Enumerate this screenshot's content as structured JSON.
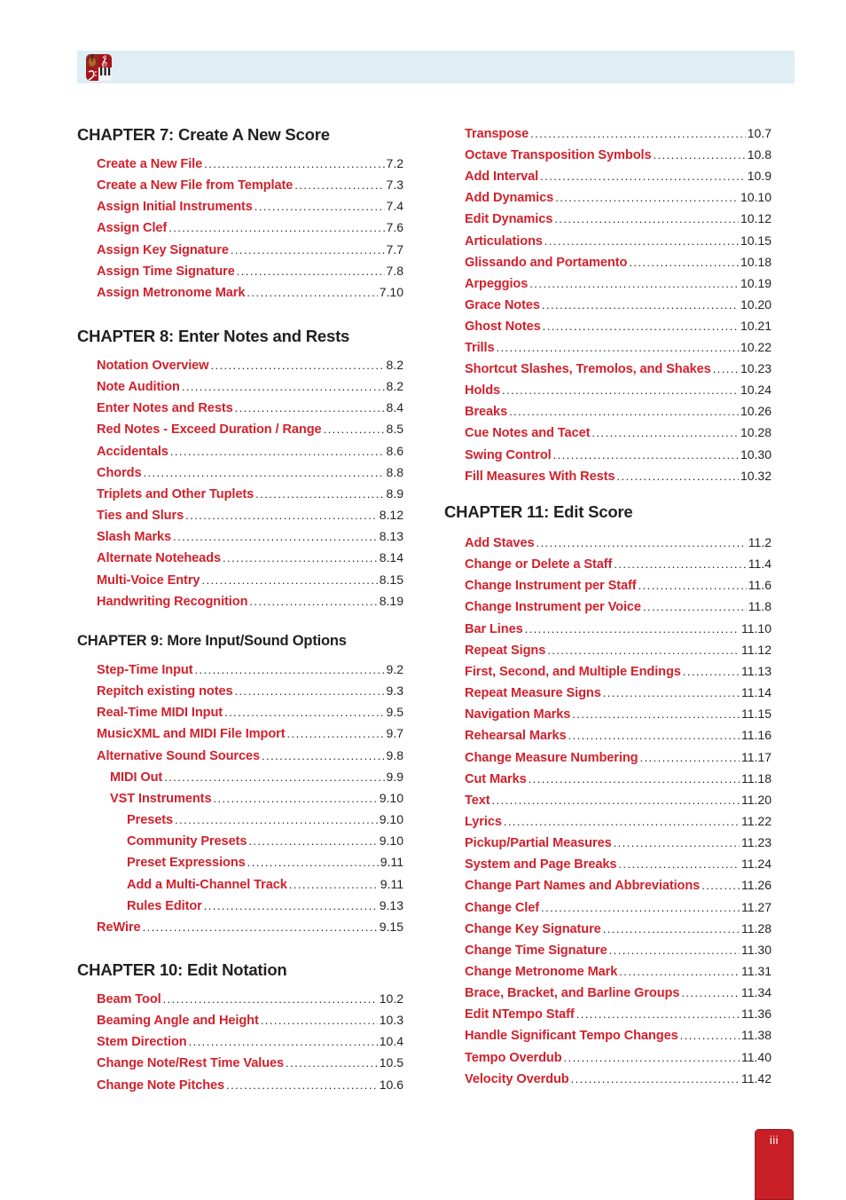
{
  "header": {
    "logo_icon": "notion-app-logo-violin-clef-piano-icon"
  },
  "left_column": [
    {
      "title": "CHAPTER 7: Create A New Score",
      "items": [
        {
          "label": "Create a New File",
          "page": "7.2",
          "indent": 0
        },
        {
          "label": "Create a New File from Template",
          "page": "7.3",
          "indent": 0
        },
        {
          "label": "Assign Initial Instruments",
          "page": "7.4",
          "indent": 0
        },
        {
          "label": "Assign Clef",
          "page": "7.6",
          "indent": 0
        },
        {
          "label": "Assign Key Signature",
          "page": "7.7",
          "indent": 0
        },
        {
          "label": "Assign Time Signature",
          "page": "7.8",
          "indent": 0
        },
        {
          "label": "Assign Metronome Mark",
          "page": "7.10",
          "indent": 0
        }
      ]
    },
    {
      "title": "CHAPTER 8: Enter Notes and Rests",
      "items": [
        {
          "label": "Notation Overview",
          "page": "8.2",
          "indent": 0
        },
        {
          "label": "Note Audition",
          "page": "8.2",
          "indent": 0
        },
        {
          "label": "Enter Notes and Rests",
          "page": "8.4",
          "indent": 0
        },
        {
          "label": "Red Notes - Exceed Duration / Range",
          "page": "8.5",
          "indent": 0
        },
        {
          "label": "Accidentals",
          "page": "8.6",
          "indent": 0
        },
        {
          "label": "Chords",
          "page": "8.8",
          "indent": 0
        },
        {
          "label": "Triplets and Other Tuplets",
          "page": "8.9",
          "indent": 0
        },
        {
          "label": "Ties and Slurs",
          "page": "8.12",
          "indent": 0
        },
        {
          "label": "Slash Marks",
          "page": "8.13",
          "indent": 0
        },
        {
          "label": "Alternate Noteheads",
          "page": "8.14",
          "indent": 0
        },
        {
          "label": "Multi-Voice Entry",
          "page": "8.15",
          "indent": 0
        },
        {
          "label": "Handwriting Recognition",
          "page": "8.19",
          "indent": 0
        }
      ]
    },
    {
      "title": "CHAPTER 9: More Input/Sound Options",
      "items": [
        {
          "label": "Step-Time Input",
          "page": "9.2",
          "indent": 0
        },
        {
          "label": "Repitch existing notes",
          "page": "9.3",
          "indent": 0
        },
        {
          "label": "Real-Time MIDI Input",
          "page": "9.5",
          "indent": 0
        },
        {
          "label": "MusicXML and MIDI File Import",
          "page": "9.7",
          "indent": 0
        },
        {
          "label": "Alternative Sound Sources",
          "page": "9.8",
          "indent": 0
        },
        {
          "label": "MIDI Out",
          "page": "9.9",
          "indent": 1
        },
        {
          "label": "VST Instruments",
          "page": "9.10",
          "indent": 1
        },
        {
          "label": "Presets",
          "page": "9.10",
          "indent": 2
        },
        {
          "label": "Community Presets",
          "page": "9.10",
          "indent": 2
        },
        {
          "label": "Preset Expressions",
          "page": "9.11",
          "indent": 2
        },
        {
          "label": "Add a Multi-Channel Track",
          "page": "9.11",
          "indent": 2
        },
        {
          "label": "Rules Editor",
          "page": "9.13",
          "indent": 2
        },
        {
          "label": "ReWire",
          "page": "9.15",
          "indent": 0
        }
      ]
    },
    {
      "title": "CHAPTER 10: Edit Notation",
      "items": [
        {
          "label": "Beam Tool",
          "page": "10.2",
          "indent": 0
        },
        {
          "label": "Beaming Angle and Height",
          "page": "10.3",
          "indent": 0
        },
        {
          "label": "Stem Direction",
          "page": "10.4",
          "indent": 0
        },
        {
          "label": "Change Note/Rest Time Values",
          "page": "10.5",
          "indent": 0
        },
        {
          "label": "Change Note Pitches",
          "page": "10.6",
          "indent": 0
        }
      ]
    }
  ],
  "right_column": [
    {
      "title": "",
      "items": [
        {
          "label": "Transpose",
          "page": "10.7",
          "indent": 0
        },
        {
          "label": "Octave Transposition Symbols",
          "page": "10.8",
          "indent": 0
        },
        {
          "label": "Add Interval",
          "page": "10.9",
          "indent": 0
        },
        {
          "label": "Add Dynamics",
          "page": "10.10",
          "indent": 0
        },
        {
          "label": "Edit Dynamics",
          "page": "10.12",
          "indent": 0
        },
        {
          "label": "Articulations",
          "page": "10.15",
          "indent": 0
        },
        {
          "label": "Glissando and Portamento",
          "page": "10.18",
          "indent": 0
        },
        {
          "label": "Arpeggios",
          "page": "10.19",
          "indent": 0
        },
        {
          "label": "Grace Notes",
          "page": "10.20",
          "indent": 0
        },
        {
          "label": "Ghost Notes",
          "page": "10.21",
          "indent": 0
        },
        {
          "label": "Trills",
          "page": "10.22",
          "indent": 0
        },
        {
          "label": "Shortcut Slashes, Tremolos, and Shakes",
          "page": "10.23",
          "indent": 0
        },
        {
          "label": "Holds",
          "page": "10.24",
          "indent": 0
        },
        {
          "label": "Breaks",
          "page": "10.26",
          "indent": 0
        },
        {
          "label": "Cue Notes and Tacet",
          "page": "10.28",
          "indent": 0
        },
        {
          "label": "Swing Control",
          "page": "10.30",
          "indent": 0
        },
        {
          "label": "Fill Measures With Rests",
          "page": "10.32",
          "indent": 0
        }
      ]
    },
    {
      "title": "CHAPTER 11: Edit Score",
      "items": [
        {
          "label": "Add Staves",
          "page": "11.2",
          "indent": 0
        },
        {
          "label": "Change or Delete a Staff",
          "page": "11.4",
          "indent": 0
        },
        {
          "label": "Change Instrument per Staff",
          "page": "11.6",
          "indent": 0
        },
        {
          "label": "Change Instrument per Voice",
          "page": "11.8",
          "indent": 0
        },
        {
          "label": "Bar Lines",
          "page": "11.10",
          "indent": 0
        },
        {
          "label": "Repeat Signs",
          "page": "11.12",
          "indent": 0
        },
        {
          "label": "First, Second, and Multiple Endings",
          "page": "11.13",
          "indent": 0
        },
        {
          "label": "Repeat Measure Signs",
          "page": "11.14",
          "indent": 0
        },
        {
          "label": "Navigation Marks",
          "page": "11.15",
          "indent": 0
        },
        {
          "label": "Rehearsal Marks",
          "page": "11.16",
          "indent": 0
        },
        {
          "label": "Change Measure Numbering",
          "page": "11.17",
          "indent": 0
        },
        {
          "label": "Cut Marks",
          "page": "11.18",
          "indent": 0
        },
        {
          "label": "Text",
          "page": "11.20",
          "indent": 0
        },
        {
          "label": "Lyrics",
          "page": "11.22",
          "indent": 0
        },
        {
          "label": "Pickup/Partial Measures",
          "page": "11.23",
          "indent": 0
        },
        {
          "label": "System and Page Breaks",
          "page": "11.24",
          "indent": 0
        },
        {
          "label": "Change Part Names and Abbreviations",
          "page": "11.26",
          "indent": 0
        },
        {
          "label": "Change Clef",
          "page": "11.27",
          "indent": 0
        },
        {
          "label": "Change Key Signature",
          "page": "11.28",
          "indent": 0
        },
        {
          "label": "Change Time Signature",
          "page": "11.30",
          "indent": 0
        },
        {
          "label": "Change Metronome Mark",
          "page": "11.31",
          "indent": 0
        },
        {
          "label": "Brace, Bracket, and Barline Groups",
          "page": "11.34",
          "indent": 0
        },
        {
          "label": "Edit NTempo Staff",
          "page": "11.36",
          "indent": 0
        },
        {
          "label": "Handle Significant Tempo Changes",
          "page": "11.38",
          "indent": 0
        },
        {
          "label": "Tempo Overdub",
          "page": "11.40",
          "indent": 0
        },
        {
          "label": "Velocity Overdub",
          "page": "11.42",
          "indent": 0
        }
      ]
    }
  ],
  "footer": {
    "page_number": "iii"
  },
  "colors": {
    "link_red": "#d0222d",
    "heading_dark": "#231f20",
    "header_bar": "#dfedf5",
    "page_tab": "#c81e26"
  }
}
